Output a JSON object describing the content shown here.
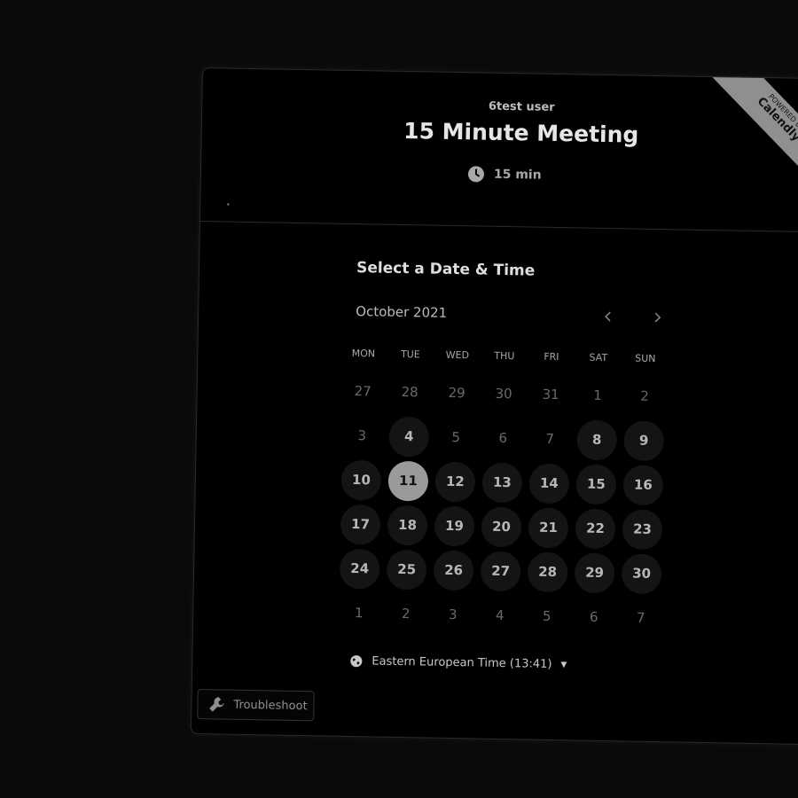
{
  "header": {
    "host_name": "6test user",
    "event_title": "15 Minute Meeting",
    "duration": "15 min",
    "ribbon_small": "POWERED BY",
    "ribbon_brand": "Calendly"
  },
  "calendar": {
    "section_title": "Select a Date & Time",
    "month_label": "October 2021",
    "prev_icon": "chevron-left-icon",
    "next_icon": "chevron-right-icon",
    "weekdays": [
      "MON",
      "TUE",
      "WED",
      "THU",
      "FRI",
      "SAT",
      "SUN"
    ],
    "days": [
      {
        "label": "27",
        "state": "outside"
      },
      {
        "label": "28",
        "state": "outside"
      },
      {
        "label": "29",
        "state": "outside"
      },
      {
        "label": "30",
        "state": "outside"
      },
      {
        "label": "31",
        "state": "outside"
      },
      {
        "label": "1",
        "state": "unavailable"
      },
      {
        "label": "2",
        "state": "unavailable"
      },
      {
        "label": "3",
        "state": "unavailable"
      },
      {
        "label": "4",
        "state": "available"
      },
      {
        "label": "5",
        "state": "unavailable"
      },
      {
        "label": "6",
        "state": "unavailable"
      },
      {
        "label": "7",
        "state": "unavailable"
      },
      {
        "label": "8",
        "state": "available"
      },
      {
        "label": "9",
        "state": "available"
      },
      {
        "label": "10",
        "state": "available"
      },
      {
        "label": "11",
        "state": "selected"
      },
      {
        "label": "12",
        "state": "available"
      },
      {
        "label": "13",
        "state": "available"
      },
      {
        "label": "14",
        "state": "available"
      },
      {
        "label": "15",
        "state": "available"
      },
      {
        "label": "16",
        "state": "available"
      },
      {
        "label": "17",
        "state": "available"
      },
      {
        "label": "18",
        "state": "available"
      },
      {
        "label": "19",
        "state": "available"
      },
      {
        "label": "20",
        "state": "available"
      },
      {
        "label": "21",
        "state": "available"
      },
      {
        "label": "22",
        "state": "available"
      },
      {
        "label": "23",
        "state": "available"
      },
      {
        "label": "24",
        "state": "available"
      },
      {
        "label": "25",
        "state": "available"
      },
      {
        "label": "26",
        "state": "available"
      },
      {
        "label": "27",
        "state": "available"
      },
      {
        "label": "28",
        "state": "available"
      },
      {
        "label": "29",
        "state": "available"
      },
      {
        "label": "30",
        "state": "available"
      },
      {
        "label": "1",
        "state": "outside"
      },
      {
        "label": "2",
        "state": "outside"
      },
      {
        "label": "3",
        "state": "outside"
      },
      {
        "label": "4",
        "state": "outside"
      },
      {
        "label": "5",
        "state": "outside"
      },
      {
        "label": "6",
        "state": "outside"
      },
      {
        "label": "7",
        "state": "outside"
      }
    ]
  },
  "timezone": {
    "label": "Eastern European Time (13:41)",
    "icon": "globe-icon"
  },
  "troubleshoot": {
    "label": "Troubleshoot",
    "icon": "wrench-icon"
  },
  "colors": {
    "background": "#000000",
    "selected_day": "#9a9a9a",
    "available_day": "#141414"
  }
}
